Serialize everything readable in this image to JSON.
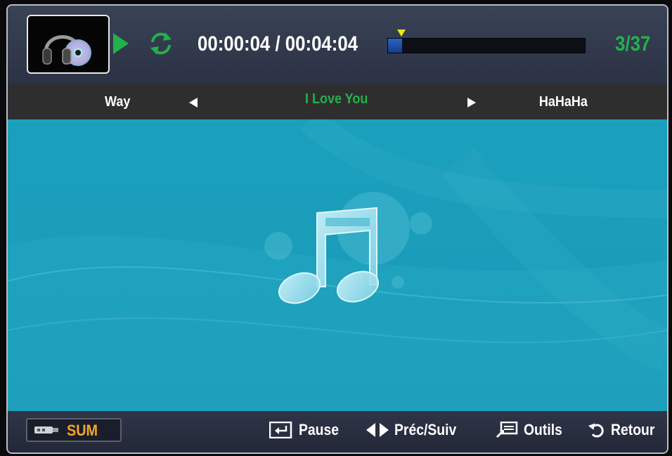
{
  "player": {
    "current_time": "00:00:04",
    "separator": "/",
    "total_time": "00:04:04",
    "progress_fraction": 0.07,
    "counter": "3/37",
    "time_display": "00:00:04 / 00:04:04"
  },
  "tracks": {
    "previous": "Way",
    "current": "I Love You",
    "next": "HaHaHa"
  },
  "footer": {
    "device_label": "SUM",
    "pause_label": "Pause",
    "prev_next_label": "Préc/Suiv",
    "tools_label": "Outils",
    "back_label": "Retour"
  },
  "colors": {
    "accent_green": "#22b14c",
    "device_orange": "#f5a623",
    "main_background": "#1c9fba",
    "marker_yellow": "#f2e21a"
  },
  "icons": {
    "thumbnail": "headphones-cd-icon",
    "play": "play-icon",
    "repeat": "repeat-icon",
    "music": "music-note-icon",
    "device": "usb-device-icon",
    "pause": "enter-key-icon",
    "prev_next": "left-right-arrows-icon",
    "tools": "tools-icon",
    "back": "return-icon"
  }
}
